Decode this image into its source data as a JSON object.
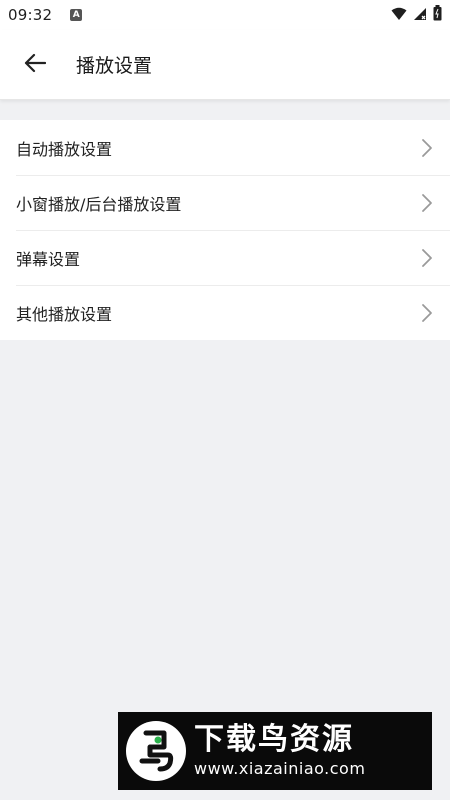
{
  "status_bar": {
    "time": "09:32",
    "notification_icon": "a-icon",
    "icons": [
      "wifi-icon",
      "signal-icon",
      "battery-icon"
    ]
  },
  "header": {
    "back_icon": "arrow-left-icon",
    "title": "播放设置"
  },
  "menu": {
    "items": [
      {
        "label": "自动播放设置",
        "icon": "chevron-right-icon"
      },
      {
        "label": "小窗播放/后台播放设置",
        "icon": "chevron-right-icon"
      },
      {
        "label": "弹幕设置",
        "icon": "chevron-right-icon"
      },
      {
        "label": "其他播放设置",
        "icon": "chevron-right-icon"
      }
    ]
  },
  "watermark": {
    "title": "下载鸟资源",
    "url": "www.xiazainiao.com"
  },
  "colors": {
    "background": "#f0f1f3",
    "surface": "#ffffff",
    "text": "#222222",
    "chevron": "#9a9a9a",
    "watermark_bg": "#0a0a0a"
  }
}
